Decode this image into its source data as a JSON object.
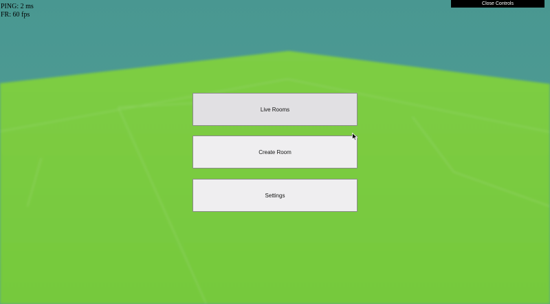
{
  "stats": {
    "ping": "PING: 2 ms",
    "framerate": "FR: 60 fps"
  },
  "controls_toggle_label": "Close Controls",
  "menu": {
    "live_rooms_label": "Live Rooms",
    "create_room_label": "Create Room",
    "settings_label": "Settings"
  },
  "colors": {
    "sky": "#4e9a94",
    "field": "#76cc3d",
    "button_bg": "#efeef0",
    "button_hover_bg": "#e1e0e3"
  }
}
